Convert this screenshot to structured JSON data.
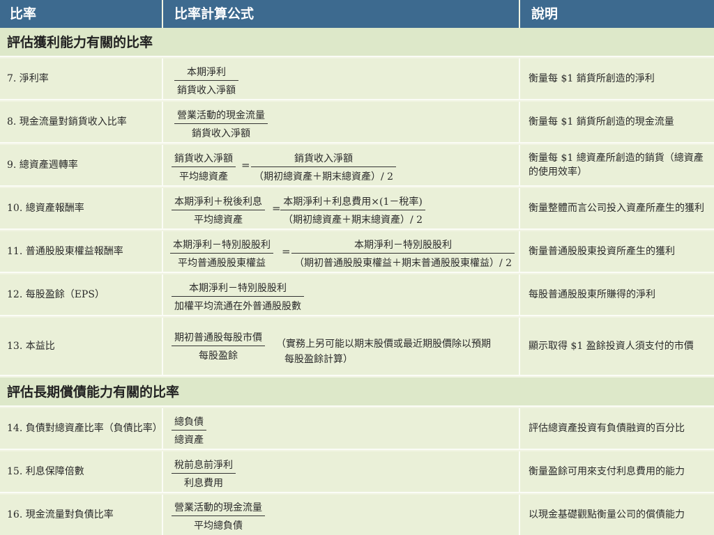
{
  "header": {
    "col1": "比率",
    "col2": "比率計算公式",
    "col3": "說明"
  },
  "sections": {
    "profit": "評估獲利能力有關的比率",
    "solvency": "評估長期償債能力有關的比率"
  },
  "rows": {
    "r7": {
      "name": "7.   淨利率",
      "num": "本期淨利",
      "den": "銷貨收入淨額",
      "desc": "衡量每 $1 銷貨所創造的淨利"
    },
    "r8": {
      "name": "8.   現金流量對銷貨收入比率",
      "num": "營業活動的現金流量",
      "den": "銷貨收入淨額",
      "desc": "衡量每 $1 銷貨所創造的現金流量"
    },
    "r9": {
      "name": "9.   總資產週轉率",
      "num": "銷貨收入淨額",
      "den": "平均總資產",
      "eq": "=",
      "num2": "銷貨收入淨額",
      "den2": "（期初總資產＋期末總資產）/ 2",
      "desc": "衡量每 $1 總資產所創造的銷貨（總資產的使用效率）"
    },
    "r10": {
      "name": "10. 總資產報酬率",
      "num": "本期淨利＋稅後利息",
      "den": "平均總資產",
      "eq": "=",
      "num2": "本期淨利＋利息費用×(1－稅率)",
      "den2": "（期初總資產＋期末總資產）/ 2",
      "desc": "衡量整體而言公司投入資產所產生的獲利"
    },
    "r11": {
      "name": "11. 普通股股東權益報酬率",
      "num": "本期淨利－特別股股利",
      "den": "平均普通股股東權益",
      "eq": "=",
      "num2": "本期淨利－特別股股利",
      "den2": "（期初普通股股東權益＋期末普通股股東權益）/ 2",
      "desc": "衡量普通股股東投資所產生的獲利"
    },
    "r12": {
      "name": "12. 每股盈餘（EPS）",
      "num": "本期淨利－特別股股利",
      "den": "加權平均流通在外普通股股數",
      "desc": "每股普通股股東所賺得的淨利"
    },
    "r13": {
      "name": "13. 本益比",
      "num": "期初普通股每股市價",
      "den": "每股盈餘",
      "note1": "（實務上另可能以期末股價或最近期股價除以預期",
      "note2": "每股盈餘計算）",
      "desc": "顯示取得 $1 盈餘投資人須支付的市價"
    },
    "r14": {
      "name": "14. 負債對總資產比率（負債比率）",
      "num": "總負債",
      "den": "總資產",
      "desc": "評估總資產投資有負債融資的百分比"
    },
    "r15": {
      "name": "15. 利息保障倍數",
      "num": "稅前息前淨利",
      "den": "利息費用",
      "desc": "衡量盈餘可用來支付利息費用的能力"
    },
    "r16": {
      "name": "16. 現金流量對負債比率",
      "num": "營業活動的現金流量",
      "den": "平均總負債",
      "desc": "以現金基礎觀點衡量公司的償債能力"
    }
  }
}
